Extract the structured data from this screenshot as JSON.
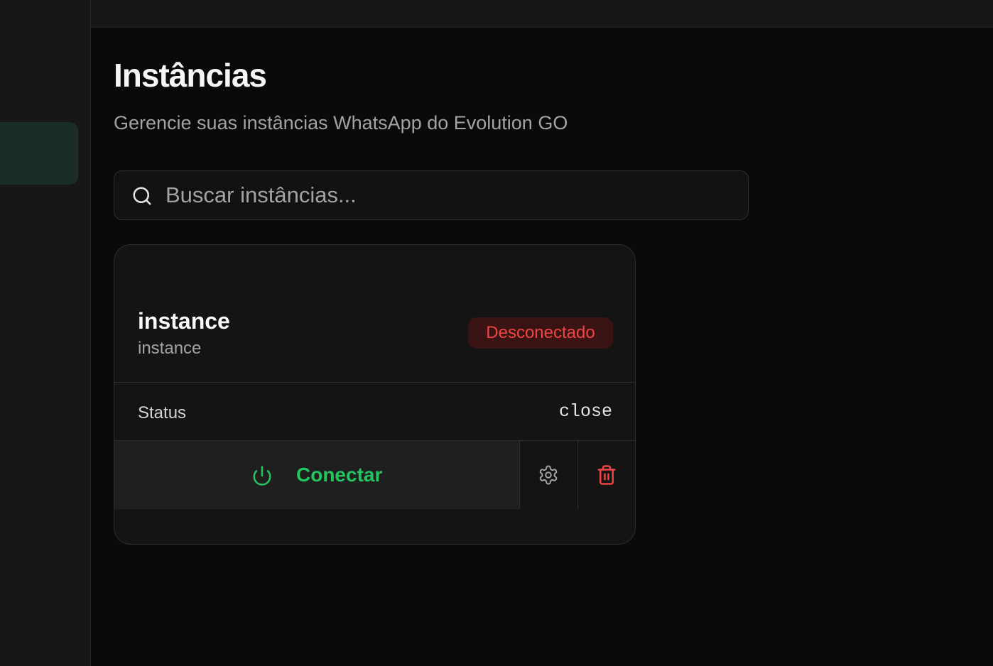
{
  "header": {
    "title": "Instâncias",
    "subtitle": "Gerencie suas instâncias WhatsApp do Evolution GO"
  },
  "search": {
    "placeholder": "Buscar instâncias...",
    "value": "",
    "icon": "search-icon"
  },
  "instances": [
    {
      "name": "instance",
      "subname": "instance",
      "badge": "Desconectado",
      "status_label": "Status",
      "status_value": "close",
      "actions": {
        "connect_label": "Conectar",
        "connect_icon": "power-icon",
        "settings_icon": "gear-icon",
        "delete_icon": "trash-icon"
      }
    }
  ],
  "colors": {
    "background": "#0a0a0a",
    "sidebar": "#171717",
    "active_item": "#1a2e25",
    "accent_green": "#22c55e",
    "danger_red": "#ef4444",
    "badge_bg": "#3a1414"
  }
}
